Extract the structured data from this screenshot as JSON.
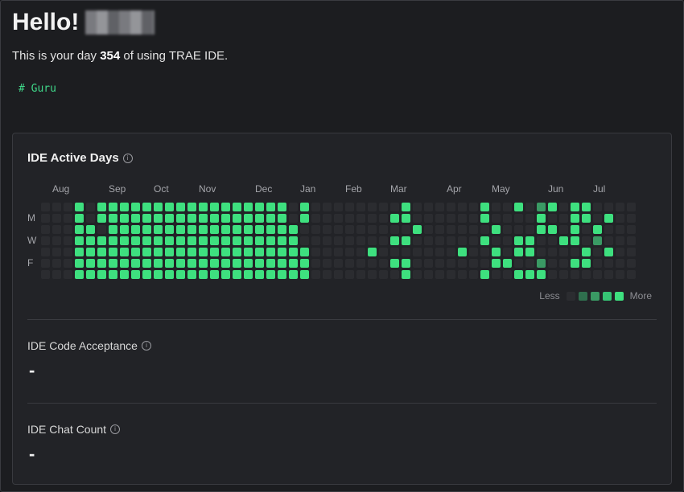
{
  "header": {
    "greeting": "Hello!",
    "sub_prefix": "This is your day ",
    "day_count": "354",
    "sub_suffix": " of using TRAE IDE.",
    "code_line": "# Guru"
  },
  "active_days": {
    "title": "IDE Active Days",
    "info_glyph": "i",
    "months": [
      {
        "label": "Aug",
        "week": 1
      },
      {
        "label": "Sep",
        "week": 6
      },
      {
        "label": "Oct",
        "week": 10
      },
      {
        "label": "Nov",
        "week": 14
      },
      {
        "label": "Dec",
        "week": 19
      },
      {
        "label": "Jan",
        "week": 23
      },
      {
        "label": "Feb",
        "week": 27
      },
      {
        "label": "Mar",
        "week": 31
      },
      {
        "label": "Apr",
        "week": 36
      },
      {
        "label": "May",
        "week": 40
      },
      {
        "label": "Jun",
        "week": 45
      },
      {
        "label": "Jul",
        "week": 49
      }
    ],
    "day_labels": [
      {
        "label": "M",
        "row": 1
      },
      {
        "label": "W",
        "row": 3
      },
      {
        "label": "F",
        "row": 5
      }
    ],
    "levels": [
      "#2b2c30",
      "#2f6f4e",
      "#3a9a64",
      "#36c474",
      "#3ee07f"
    ],
    "grid": [
      "00040444444444444444440400000000400000040",
      "00040444444444444444440400000004400000040",
      "00044044444444444444444000000000040000004",
      "00044444444444444444444000000004400000040",
      "00044444444444444444444400000400000004004",
      "00044444444444444444444400000004400000004",
      "00044444444444444444444400000000400000040"
    ],
    "grid_tail": [
      "04024044000000000040000000",
      "00040044040000000000000000",
      "00044040400000000000000000",
      "04400440200000000000000000",
      "04400004040000000000000000",
      "40020044000000000000000000",
      "04440000000000000000000000"
    ],
    "legend_less": "Less",
    "legend_more": "More"
  },
  "metrics": [
    {
      "label": "IDE Code Acceptance",
      "value": "-"
    },
    {
      "label": "IDE Chat Count",
      "value": "-"
    }
  ]
}
